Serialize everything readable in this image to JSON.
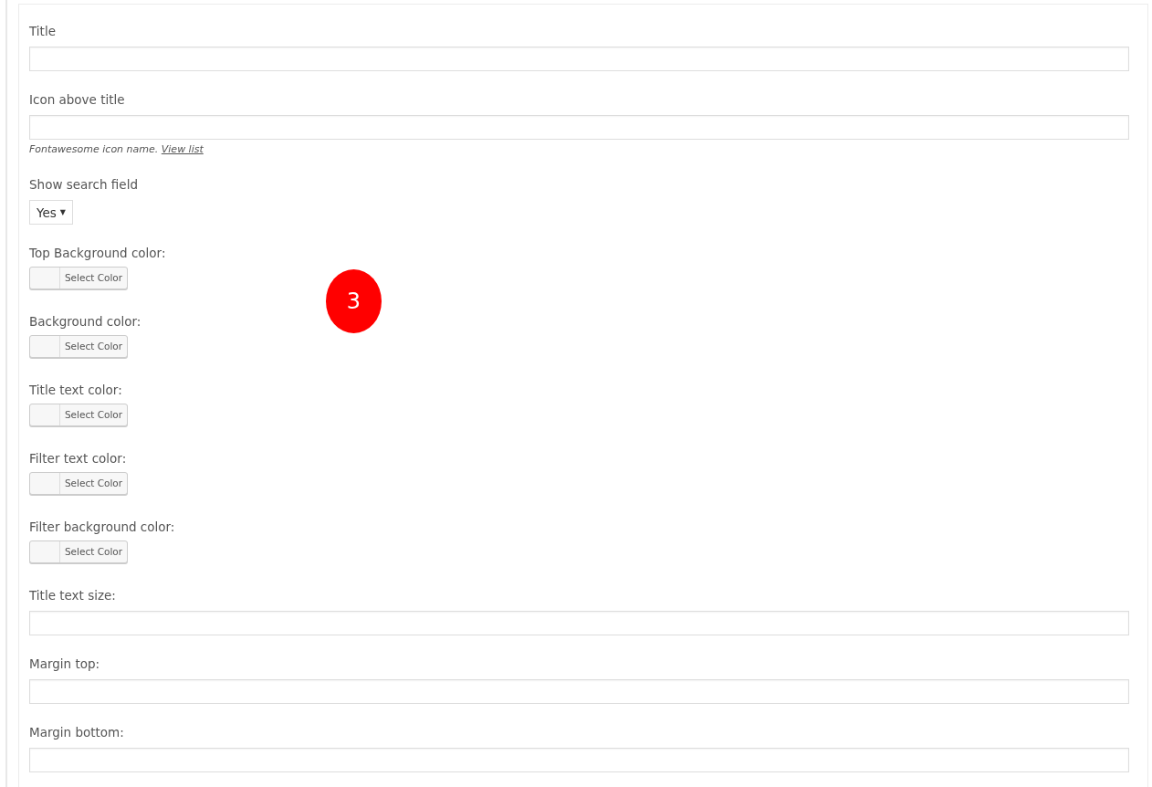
{
  "fields": [
    {
      "kind": "text",
      "label": "Title"
    },
    {
      "kind": "text",
      "label": "Icon above title",
      "hint": "Fontawesome icon name.",
      "hint_link": "View list"
    },
    {
      "kind": "select",
      "label": "Show search field",
      "value": "Yes",
      "caret": "▼"
    },
    {
      "kind": "color",
      "label": "Top Background color:",
      "button": "Select Color"
    },
    {
      "kind": "color",
      "label": "Background color:",
      "button": "Select Color"
    },
    {
      "kind": "color",
      "label": "Title text color:",
      "button": "Select Color"
    },
    {
      "kind": "color",
      "label": "Filter text color:",
      "button": "Select Color"
    },
    {
      "kind": "color",
      "label": "Filter background color:",
      "button": "Select Color"
    },
    {
      "kind": "text",
      "label": "Title text size:"
    },
    {
      "kind": "text",
      "label": "Margin top:"
    },
    {
      "kind": "text",
      "label": "Margin bottom:"
    }
  ],
  "annotation_badge": "3"
}
